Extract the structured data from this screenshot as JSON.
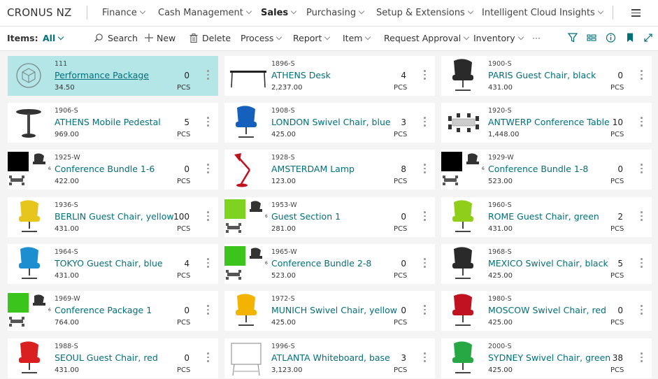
{
  "app": {
    "brand": "CRONUS NZ"
  },
  "nav": {
    "items": [
      {
        "label": "Finance"
      },
      {
        "label": "Cash Management"
      },
      {
        "label": "Sales"
      },
      {
        "label": "Purchasing"
      },
      {
        "label": "Setup & Extensions"
      },
      {
        "label": "Intelligent Cloud Insights"
      }
    ],
    "active": "Sales"
  },
  "actionbar": {
    "items_label": "Items:",
    "filter_value": "All",
    "search": "Search",
    "new": "New",
    "delete": "Delete",
    "process": "Process",
    "report": "Report",
    "item": "Item",
    "request_approval": "Request Approval",
    "inventory": "Inventory",
    "more": "···"
  },
  "tiles": [
    {
      "no": "111",
      "desc": "Performance Package",
      "price": "34.50",
      "qty": "0",
      "unit": "PCS",
      "img": "package-icon",
      "selected": true
    },
    {
      "no": "1896-S",
      "desc": "ATHENS Desk",
      "price": "2,237.00",
      "qty": "4",
      "unit": "PCS",
      "img": "desk-image"
    },
    {
      "no": "1900-S",
      "desc": "PARIS Guest Chair, black",
      "price": "431.00",
      "qty": "0",
      "unit": "PCS",
      "img": "chair-image"
    },
    {
      "no": "1906-S",
      "desc": "ATHENS Mobile Pedestal",
      "price": "969.00",
      "qty": "5",
      "unit": "PCS",
      "img": "pedestal-image"
    },
    {
      "no": "1908-S",
      "desc": "LONDON Swivel Chair, blue",
      "price": "425.00",
      "qty": "3",
      "unit": "PCS",
      "img": "chair-image"
    },
    {
      "no": "1920-S",
      "desc": "ANTWERP Conference Table",
      "price": "1,448.00",
      "qty": "10",
      "unit": "PCS",
      "img": "table-image"
    },
    {
      "no": "1925-W",
      "desc": "Conference Bundle 1-6",
      "price": "422.00",
      "qty": "0",
      "unit": "PCS",
      "img": "bundle-image"
    },
    {
      "no": "1928-S",
      "desc": "AMSTERDAM Lamp",
      "price": "123.00",
      "qty": "8",
      "unit": "PCS",
      "img": "lamp-image"
    },
    {
      "no": "1929-W",
      "desc": "Conference Bundle 1-8",
      "price": "523.00",
      "qty": "0",
      "unit": "PCS",
      "img": "bundle-image"
    },
    {
      "no": "1936-S",
      "desc": "BERLIN Guest Chair, yellow",
      "price": "431.00",
      "qty": "100",
      "unit": "PCS",
      "img": "chair-image"
    },
    {
      "no": "1953-W",
      "desc": "Guest Section 1",
      "price": "281.00",
      "qty": "0",
      "unit": "PCS",
      "img": "bundle-image"
    },
    {
      "no": "1960-S",
      "desc": "ROME Guest Chair, green",
      "price": "431.00",
      "qty": "2",
      "unit": "PCS",
      "img": "chair-image"
    },
    {
      "no": "1964-S",
      "desc": "TOKYO Guest Chair, blue",
      "price": "431.00",
      "qty": "4",
      "unit": "PCS",
      "img": "chair-image"
    },
    {
      "no": "1965-W",
      "desc": "Conference Bundle 2-8",
      "price": "523.00",
      "qty": "0",
      "unit": "PCS",
      "img": "bundle-image"
    },
    {
      "no": "1968-S",
      "desc": "MEXICO Swivel Chair, black",
      "price": "425.00",
      "qty": "5",
      "unit": "PCS",
      "img": "chair-image"
    },
    {
      "no": "1969-W",
      "desc": "Conference Package 1",
      "price": "764.00",
      "qty": "0",
      "unit": "PCS",
      "img": "bundle-image"
    },
    {
      "no": "1972-S",
      "desc": "MUNICH Swivel Chair, yellow",
      "price": "425.00",
      "qty": "0",
      "unit": "PCS",
      "img": "chair-image"
    },
    {
      "no": "1980-S",
      "desc": "MOSCOW Swivel Chair, red",
      "price": "425.00",
      "qty": "0",
      "unit": "PCS",
      "img": "chair-image"
    },
    {
      "no": "1988-S",
      "desc": "SEOUL Guest Chair, red",
      "price": "431.00",
      "qty": "0",
      "unit": "PCS",
      "img": "chair-image"
    },
    {
      "no": "1996-S",
      "desc": "ATLANTA Whiteboard, base",
      "price": "3,123.00",
      "qty": "3",
      "unit": "PCS",
      "img": "whiteboard-image"
    },
    {
      "no": "2000-S",
      "desc": "SYDNEY Swivel Chair, green",
      "price": "425.00",
      "qty": "38",
      "unit": "PCS",
      "img": "chair-image"
    }
  ],
  "colors": {
    "accent": "#00707a",
    "selected_tile": "#b4e5e7",
    "page_bg": "#f4f4f4"
  }
}
